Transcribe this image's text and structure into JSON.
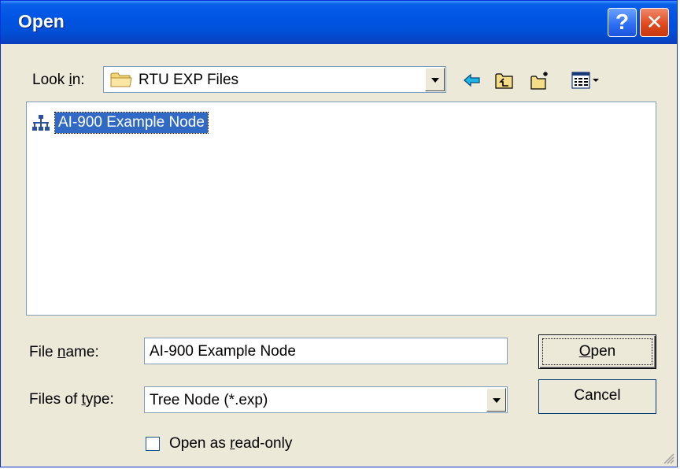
{
  "dialog": {
    "title": "Open",
    "help_label": "?",
    "close_label": "✕"
  },
  "look_in": {
    "label_pre": "Look ",
    "label_ul": "i",
    "label_post": "n:",
    "value": "RTU EXP Files"
  },
  "toolbar": {
    "icons": [
      "back-arrow-icon",
      "up-one-level-icon",
      "create-new-folder-icon",
      "view-menu-icon"
    ]
  },
  "file_list": {
    "items": [
      {
        "label": "AI-900 Example Node",
        "icon": "tree-node-icon",
        "selected": true
      }
    ]
  },
  "file_name": {
    "label_pre": "File ",
    "label_ul": "n",
    "label_post": "ame:",
    "value": "AI-900 Example Node"
  },
  "file_type": {
    "label_pre": "Files of ",
    "label_ul": "t",
    "label_post": "ype:",
    "value": "Tree Node (*.exp)"
  },
  "buttons": {
    "open_ul": "O",
    "open_rest": "pen",
    "cancel": "Cancel"
  },
  "readonly": {
    "label_pre": "Open as ",
    "label_ul": "r",
    "label_post": "ead-only",
    "checked": false
  },
  "colors": {
    "title_bar": "#0054e3",
    "dialog_bg": "#ece9d8",
    "selection": "#316ac5"
  }
}
